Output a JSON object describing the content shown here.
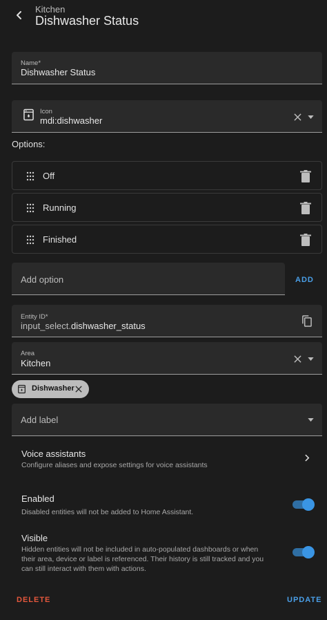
{
  "header": {
    "subtitle": "Kitchen",
    "title": "Dishwasher Status"
  },
  "name_field": {
    "label": "Name*",
    "value": "Dishwasher Status"
  },
  "icon_field": {
    "label": "Icon",
    "value": "mdi:dishwasher",
    "icon": "dishwasher-icon"
  },
  "options_label": "Options:",
  "options": [
    {
      "label": "Off"
    },
    {
      "label": "Running"
    },
    {
      "label": "Finished"
    }
  ],
  "add_option": {
    "placeholder": "Add option",
    "button": "ADD"
  },
  "entity_id_field": {
    "label": "Entity ID*",
    "prefix": "input_select.",
    "value": "dishwasher_status"
  },
  "area_field": {
    "label": "Area",
    "value": "Kitchen"
  },
  "device_chip": {
    "label": "Dishwasher",
    "icon": "dishwasher-icon"
  },
  "add_label": {
    "placeholder": "Add label"
  },
  "voice_assistants": {
    "title": "Voice assistants",
    "description": "Configure aliases and expose settings for voice assistants"
  },
  "enabled": {
    "title": "Enabled",
    "description": "Disabled entities will not be added to Home Assistant.",
    "on": true
  },
  "visible": {
    "title": "Visible",
    "description_lines": [
      "Hidden entities will not be included in auto-populated dashboards or when",
      "their area, device or label is referenced. Their history is still tracked and you",
      "can still interact with them with actions."
    ],
    "on": true
  },
  "footer": {
    "delete": "DELETE",
    "update": "UPDATE"
  },
  "colors": {
    "accent": "#4a9fe8",
    "delete": "#e4573c",
    "background": "#1c1c1c",
    "field": "#2a2a2a"
  }
}
